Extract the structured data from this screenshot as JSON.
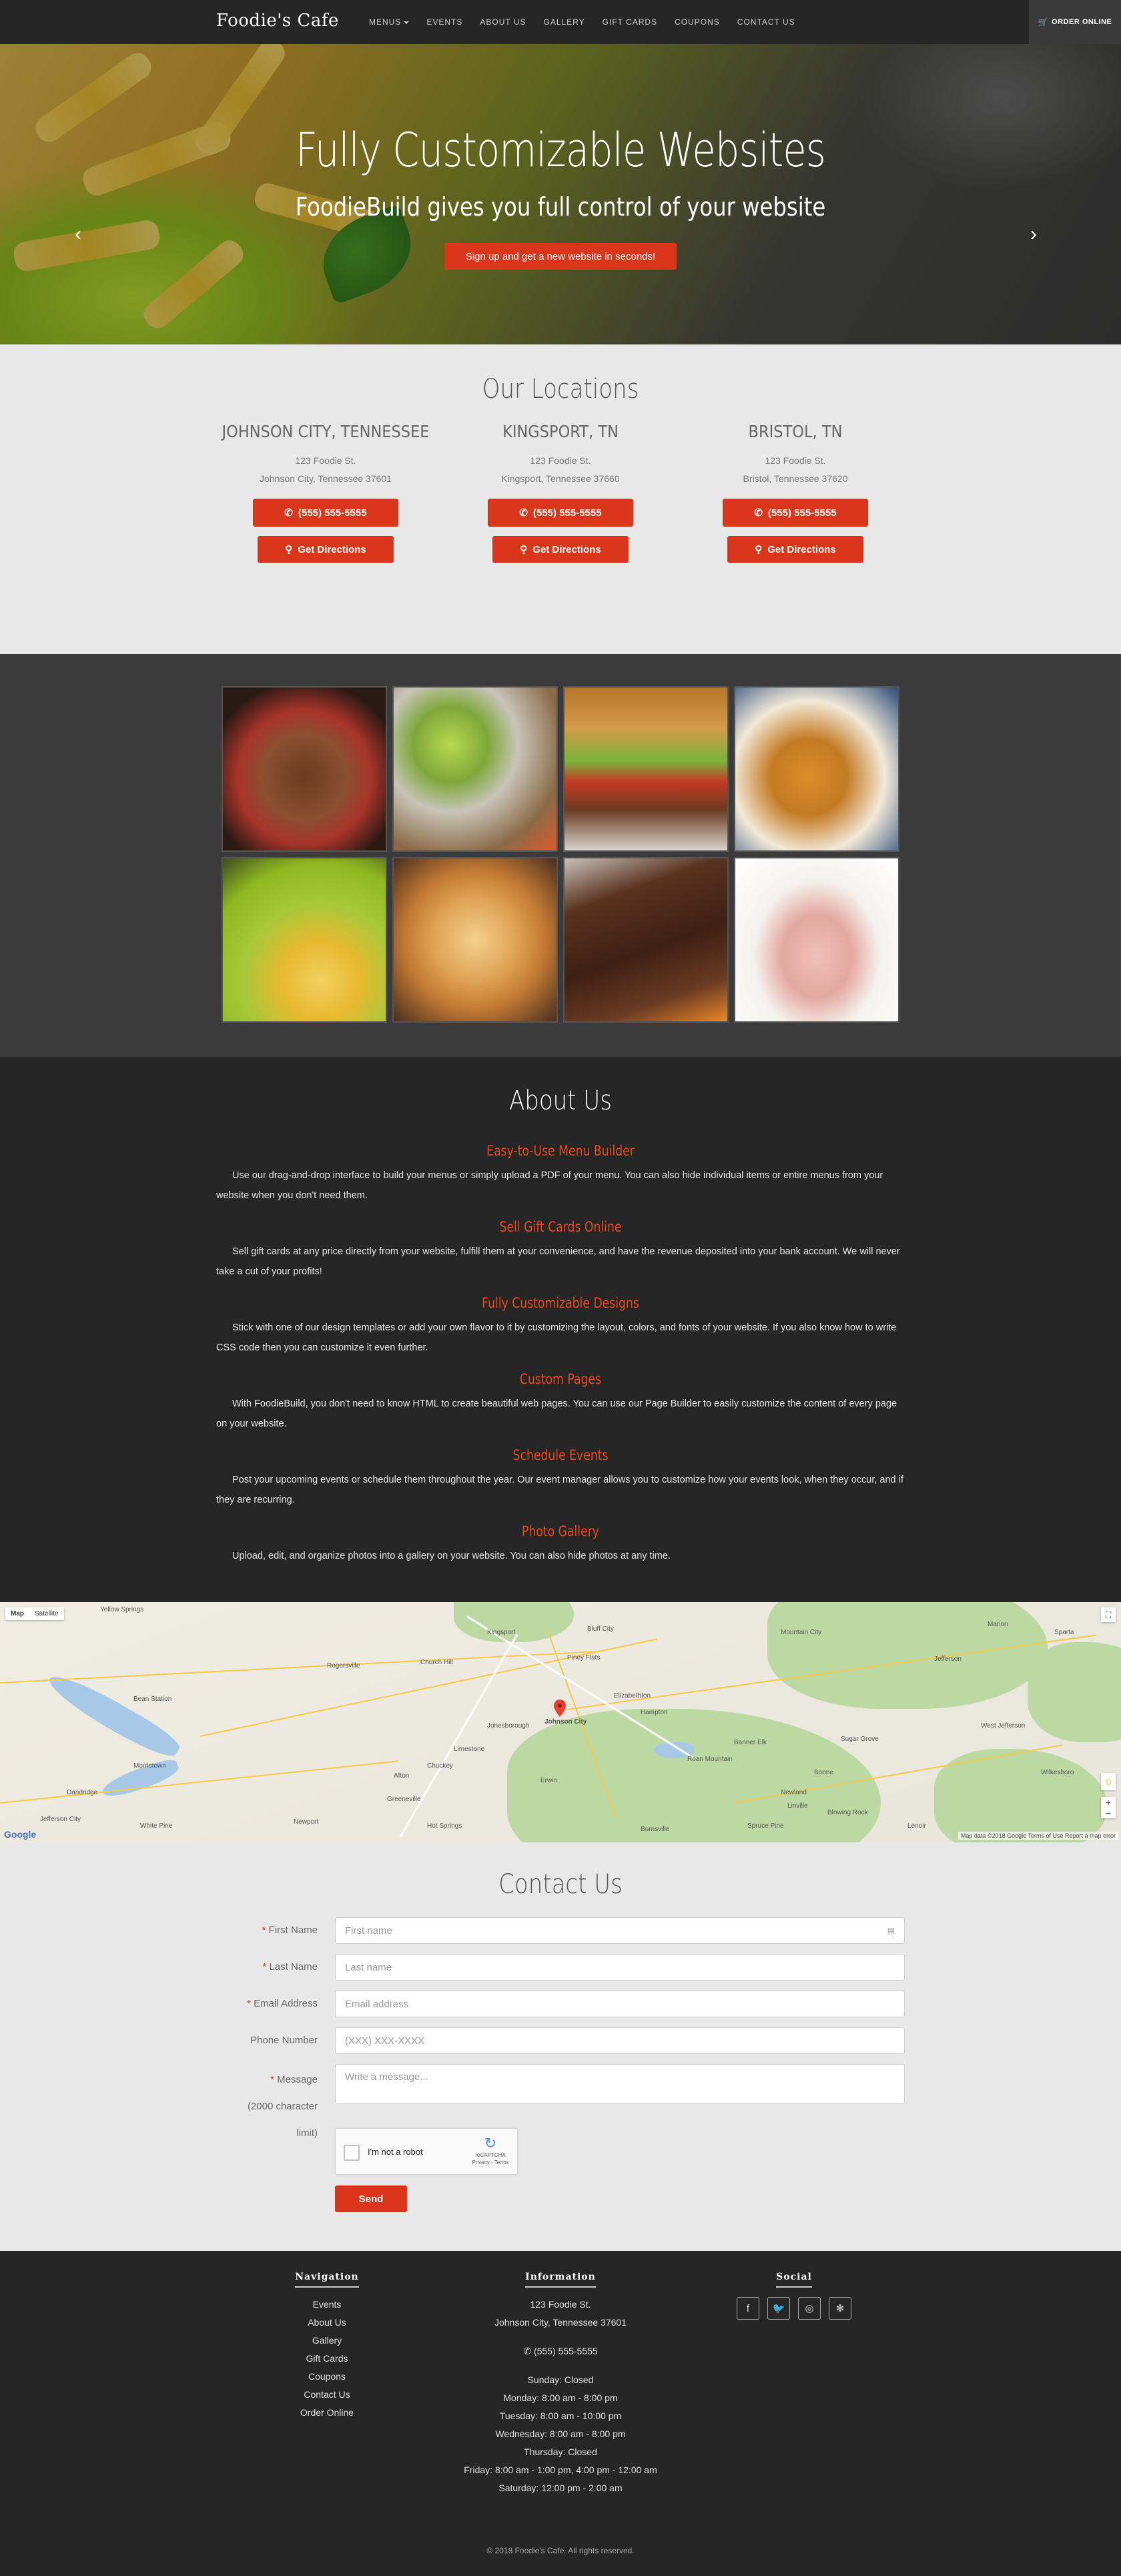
{
  "nav": {
    "brand": "Foodie's Cafe",
    "menus_label": "MENUS",
    "links": [
      "EVENTS",
      "ABOUT US",
      "GALLERY",
      "GIFT CARDS",
      "COUPONS",
      "CONTACT US"
    ],
    "order_online": "ORDER ONLINE"
  },
  "hero": {
    "title": "Fully Customizable Websites",
    "subtitle": "FoodieBuild gives you full control of your website",
    "cta": "Sign up and get a new website in seconds!",
    "prev": "‹",
    "next": "›"
  },
  "locations": {
    "title": "Our Locations",
    "items": [
      {
        "name": "JOHNSON CITY, TENNESSEE",
        "street": "123 Foodie St.",
        "city": "Johnson City, Tennessee 37601",
        "phone": "(555) 555-5555",
        "directions": "Get Directions"
      },
      {
        "name": "KINGSPORT, TN",
        "street": "123 Foodie St.",
        "city": "Kingsport, Tennessee 37660",
        "phone": "(555) 555-5555",
        "directions": "Get Directions"
      },
      {
        "name": "BRISTOL, TN",
        "street": "123 Foodie St.",
        "city": "Bristol, Tennessee 37620",
        "phone": "(555) 555-5555",
        "directions": "Get Directions"
      }
    ]
  },
  "gallery": {
    "tiles": [
      "granola",
      "lime-drink",
      "burger",
      "croissants",
      "pasta",
      "pizza",
      "brownies",
      "salmon-mousse"
    ]
  },
  "about": {
    "title": "About Us",
    "features": [
      {
        "title": "Easy-to-Use Menu Builder",
        "text": "Use our drag-and-drop interface to build your menus or simply upload a PDF of your menu. You can also hide individual items or entire menus from your website when you don't need them."
      },
      {
        "title": "Sell Gift Cards Online",
        "text": "Sell gift cards at any price directly from your website, fulfill them at your convenience, and have the revenue deposited into your bank account. We will never take a cut of your profits!"
      },
      {
        "title": "Fully Customizable Designs",
        "text": "Stick with one of our design templates or add your own flavor to it by customizing the layout, colors, and fonts of your website. If you also know how to write CSS code then you can customize it even further."
      },
      {
        "title": "Custom Pages",
        "text": "With FoodieBuild, you don't need to know HTML to create beautiful web pages. You can use our Page Builder to easily customize the content of every page on your website."
      },
      {
        "title": "Schedule Events",
        "text": "Post your upcoming events or schedule them throughout the year. Our event manager allows you to customize how your events look, when they occur, and if they are recurring."
      },
      {
        "title": "Photo Gallery",
        "text": "Upload, edit, and organize photos into a gallery on your website. You can also hide photos at any time."
      }
    ]
  },
  "map": {
    "toggle_map": "Map",
    "toggle_satellite": "Satellite",
    "pin_label": "Johnson City",
    "labels": [
      "Yellow Springs",
      "Kingsport",
      "Bluff City",
      "Piney Flats",
      "Elizabethton",
      "Hampton",
      "Jonesborough",
      "Greeneville",
      "Erwin",
      "Newport",
      "Morristown",
      "Bean Station",
      "Rogersville",
      "Church Hill",
      "Mountain City",
      "Jefferson",
      "Marion",
      "Hot Springs",
      "Spruce Pine",
      "Burnsville",
      "Banner Elk",
      "Boone",
      "Blowing Rock",
      "Lenoir",
      "Wilkesboro",
      "Sparta",
      "Sugar Grove",
      "West Jefferson",
      "Limestone",
      "Afton",
      "Chuckey",
      "Roan Mountain",
      "Newland",
      "Linville",
      "Jefferson City",
      "Dandridge",
      "White Pine"
    ],
    "footer": "Map data ©2018 Google   Terms of Use   Report a map error",
    "google": "Google"
  },
  "contact": {
    "title": "Contact Us",
    "fields": [
      {
        "label": "First Name",
        "required": true,
        "placeholder": "First name"
      },
      {
        "label": "Last Name",
        "required": true,
        "placeholder": "Last name"
      },
      {
        "label": "Email Address",
        "required": true,
        "placeholder": "Email address"
      },
      {
        "label": "Phone Number",
        "required": false,
        "placeholder": "(XXX) XXX-XXXX"
      },
      {
        "label": "Message (2000 character limit)",
        "required": true,
        "placeholder": "Write a message..."
      }
    ],
    "captcha_text": "I'm not a robot",
    "captcha_brand": "reCAPTCHA",
    "captcha_links": "Privacy - Terms",
    "send": "Send"
  },
  "footer": {
    "navigation": {
      "title": "Navigation",
      "links": [
        "Events",
        "About Us",
        "Gallery",
        "Gift Cards",
        "Coupons",
        "Contact Us",
        "Order Online"
      ]
    },
    "information": {
      "title": "Information",
      "street": "123 Foodie St.",
      "city": "Johnson City, Tennessee 37601",
      "phone": "(555) 555-5555",
      "hours": [
        "Sunday: Closed",
        "Monday: 8:00 am - 8:00 pm",
        "Tuesday: 8:00 am - 10:00 pm",
        "Wednesday: 8:00 am - 8:00 pm",
        "Thursday: Closed",
        "Friday: 8:00 am - 1:00 pm, 4:00 pm - 12:00 am",
        "Saturday: 12:00 pm - 2:00 am"
      ]
    },
    "social": {
      "title": "Social",
      "icons": [
        "facebook-icon",
        "twitter-icon",
        "instagram-icon",
        "yelp-icon"
      ]
    },
    "copyright": "© 2018 Foodie's Cafe. All rights reserved."
  },
  "colors": {
    "accent": "#d9361c",
    "feature_title": "#e8491e",
    "dark": "#262626"
  }
}
